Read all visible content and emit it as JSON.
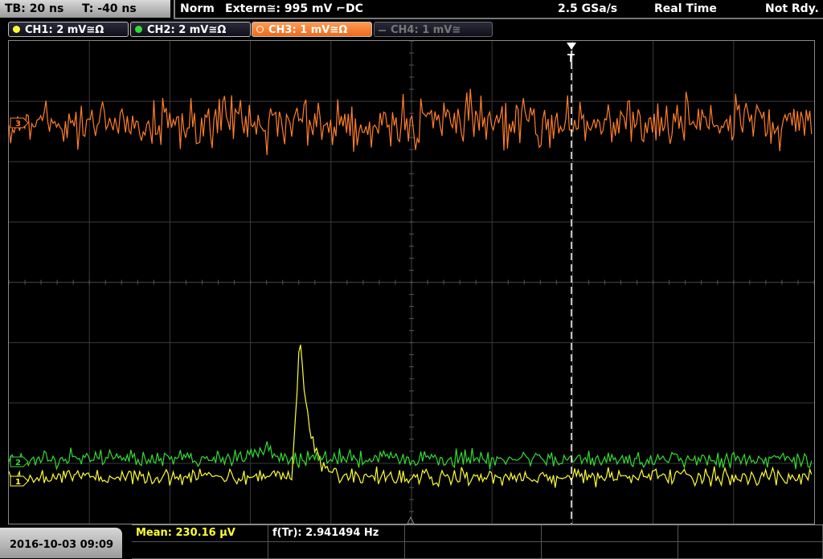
{
  "header": {
    "timebase": "TB: 20 ns",
    "trigger_time": "T: -40 ns",
    "mode": "Norm",
    "trigger_source": "Extern≅: 995 mV ⌐DC",
    "sample_rate": "2.5 GSa/s",
    "acq_mode": "Real Time",
    "state": "Not Rdy."
  },
  "channels": [
    {
      "label": "CH1: 2 mV≅Ω",
      "color": "#ffff33",
      "state": "normal"
    },
    {
      "label": "CH2: 2 mV≅Ω",
      "color": "#33dd33",
      "state": "normal"
    },
    {
      "label": "CH3: 1 mV≅Ω",
      "color": "#ff7f2a",
      "state": "active"
    },
    {
      "label": "CH4: 1 mV≅",
      "color": "#777777",
      "state": "off"
    }
  ],
  "markers": {
    "trigger_label": "T",
    "ch1": "1",
    "ch2": "2",
    "ch3": "3"
  },
  "footer": {
    "datetime": "2016-10-03 09:09",
    "mean": "Mean: 230.16 µV",
    "freq": "f(Tr): 2.941494 Hz"
  },
  "colors": {
    "ch1": "#ffff33",
    "ch2": "#33dd33",
    "ch3": "#ff7f2a",
    "grid": "#3a3a3a"
  }
}
